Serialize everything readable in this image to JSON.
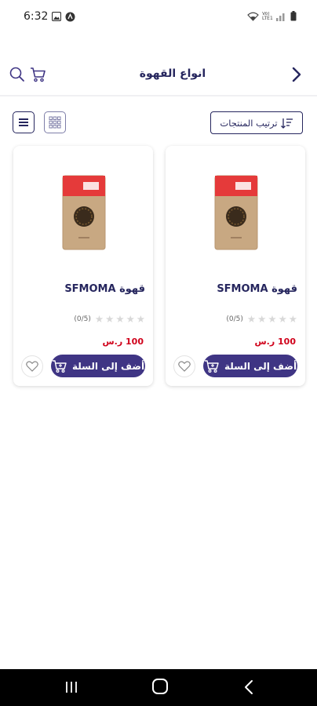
{
  "status_bar": {
    "time": "6:32",
    "network": "Vo) LTE1"
  },
  "header": {
    "title": "انواع القهوة"
  },
  "toolbar": {
    "sort_label": "ترتيب المنتجات"
  },
  "products": [
    {
      "name": "قهوة SFMOMA",
      "rating_count": "(0/5)",
      "rating": 0,
      "price": "100 ر.س",
      "add_to_cart_label": "أضف إلى السلة"
    },
    {
      "name": "قهوة SFMOMA",
      "rating_count": "(0/5)",
      "rating": 0,
      "price": "100 ر.س",
      "add_to_cart_label": "أضف إلى السلة"
    }
  ],
  "colors": {
    "primary": "#3f3584",
    "title": "#26265e",
    "price": "#d0021b",
    "star_empty": "#d8d8d8",
    "bag": "#c8a882",
    "bag_label": "#e53a3a"
  },
  "icons": [
    "back-icon",
    "search-icon",
    "cart-icon",
    "list-view-icon",
    "grid-view-icon",
    "sort-icon",
    "add-cart-icon",
    "heart-icon",
    "star-icon"
  ]
}
